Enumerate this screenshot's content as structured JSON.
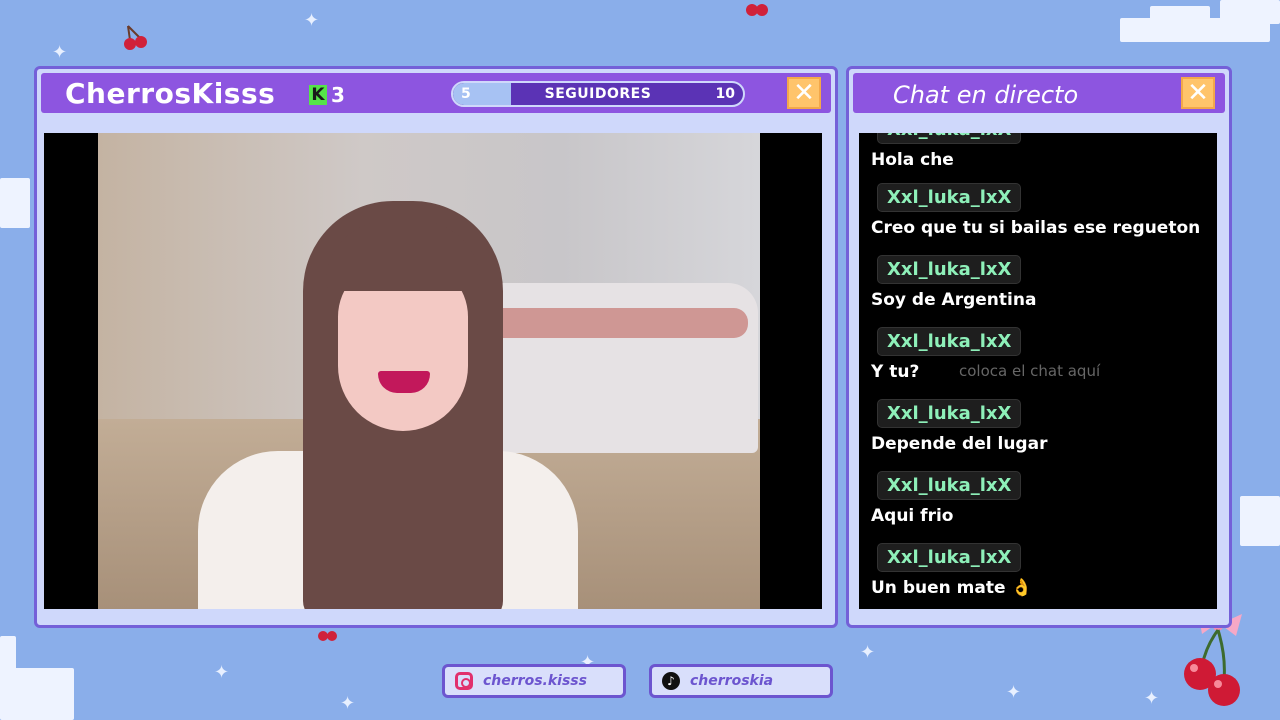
{
  "stream": {
    "title": "CherrosKisss",
    "kick_icon": "kick-logo-icon",
    "kick_count": "3",
    "followers": {
      "label": "SEGUIDORES",
      "min": "5",
      "max": "10",
      "progress": 0.2
    },
    "close_icon": "close-icon",
    "close_label": "✕"
  },
  "chat": {
    "title": "Chat en directo",
    "close_label": "✕",
    "placeholder": "coloca el chat aquí",
    "messages": [
      {
        "user": "Xxl_luka_lxX",
        "text": "Hola che"
      },
      {
        "user": "Xxl_luka_lxX",
        "text": "Creo que tu si bailas ese regueton"
      },
      {
        "user": "Xxl_luka_lxX",
        "text": "Soy de Argentina"
      },
      {
        "user": "Xxl_luka_lxX",
        "text": "Y tu?"
      },
      {
        "user": "Xxl_luka_lxX",
        "text": "Depende del lugar"
      },
      {
        "user": "Xxl_luka_lxX",
        "text": "Aqui frio"
      },
      {
        "user": "Xxl_luka_lxX",
        "text": "Un buen mate 👌"
      }
    ]
  },
  "socials": {
    "instagram": {
      "icon": "instagram-icon",
      "handle": "cherros.kisss"
    },
    "tiktok": {
      "icon": "tiktok-icon",
      "handle": "cherroskia"
    }
  },
  "colors": {
    "background": "#8aaeea",
    "accent": "#8d55e0",
    "border": "#7460d8",
    "close_button": "#ffc46b",
    "chat_username": "#8ef0b9"
  }
}
